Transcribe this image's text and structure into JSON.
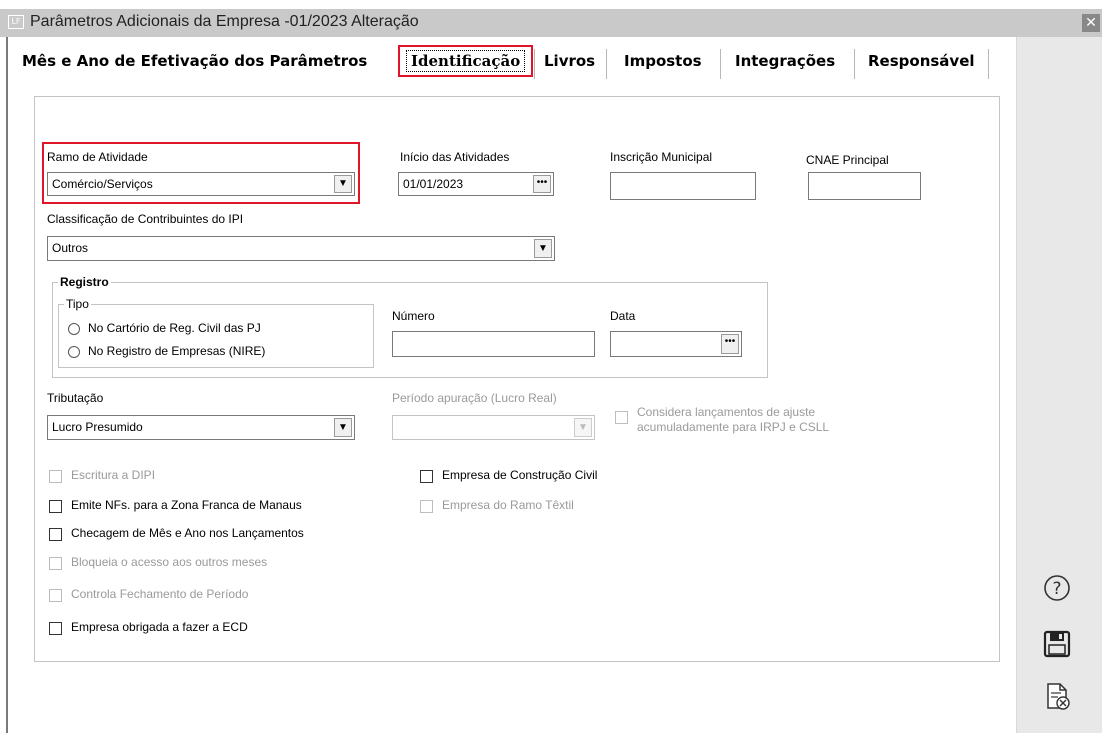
{
  "window": {
    "title": "Parâmetros Adicionais da Empresa -01/2023 Alteração",
    "app_icon_text": "LF",
    "close_glyph": "✕"
  },
  "tabs": [
    {
      "label": "Mês e Ano de Efetivação dos Parâmetros",
      "active": false
    },
    {
      "label": "Identificação",
      "active": true
    },
    {
      "label": "Livros",
      "active": false
    },
    {
      "label": "Impostos",
      "active": false
    },
    {
      "label": "Integrações",
      "active": false
    },
    {
      "label": "Responsável",
      "active": false
    }
  ],
  "form": {
    "ramo": {
      "label": "Ramo de Atividade",
      "value": "Comércio/Serviços"
    },
    "inicio": {
      "label": "Início das Atividades",
      "value": "01/01/2023"
    },
    "inscricao": {
      "label": "Inscrição Municipal",
      "value": ""
    },
    "cnae": {
      "label": "CNAE Principal",
      "value": ""
    },
    "classificacao": {
      "label": "Classificação de Contribuintes do IPI",
      "value": "Outros"
    },
    "registro": {
      "title": "Registro",
      "tipo_title": "Tipo",
      "options": [
        "No Cartório de Reg. Civil das PJ",
        "No Registro de Empresas (NIRE)"
      ],
      "numero": {
        "label": "Número",
        "value": ""
      },
      "data": {
        "label": "Data",
        "value": ""
      }
    },
    "tributacao": {
      "label": "Tributação",
      "value": "Lucro Presumido"
    },
    "periodo": {
      "label": "Período apuração (Lucro Real)",
      "value": ""
    },
    "considera": {
      "label_line1": "Considera lançamentos de ajuste",
      "label_line2": "acumuladamente para IRPJ e CSLL"
    },
    "checkboxes_left": [
      {
        "label": "Escritura a DIPI",
        "enabled": false,
        "checked": false
      },
      {
        "label": "Emite NFs. para a Zona Franca de Manaus",
        "enabled": true,
        "checked": false
      },
      {
        "label": "Checagem de Mês e Ano nos Lançamentos",
        "enabled": true,
        "checked": false
      },
      {
        "label": "Bloqueia o acesso aos outros meses",
        "enabled": false,
        "checked": false
      },
      {
        "label": "Controla Fechamento de Período",
        "enabled": false,
        "checked": false
      },
      {
        "label": "Empresa obrigada a fazer a ECD",
        "enabled": true,
        "checked": false
      }
    ],
    "checkboxes_right": [
      {
        "label": "Empresa de Construção Civil",
        "enabled": true,
        "checked": false
      },
      {
        "label": "Empresa do Ramo Têxtil",
        "enabled": false,
        "checked": false
      }
    ]
  },
  "sidebar": {
    "icons": [
      "help-icon",
      "save-icon",
      "cancel-document-icon"
    ],
    "help_glyph": "?"
  },
  "colors": {
    "highlight": "#e0152a",
    "titlebar": "#c9c9c9",
    "sidebar": "#e8e8e8",
    "disabled_text": "#9a9a9a"
  }
}
